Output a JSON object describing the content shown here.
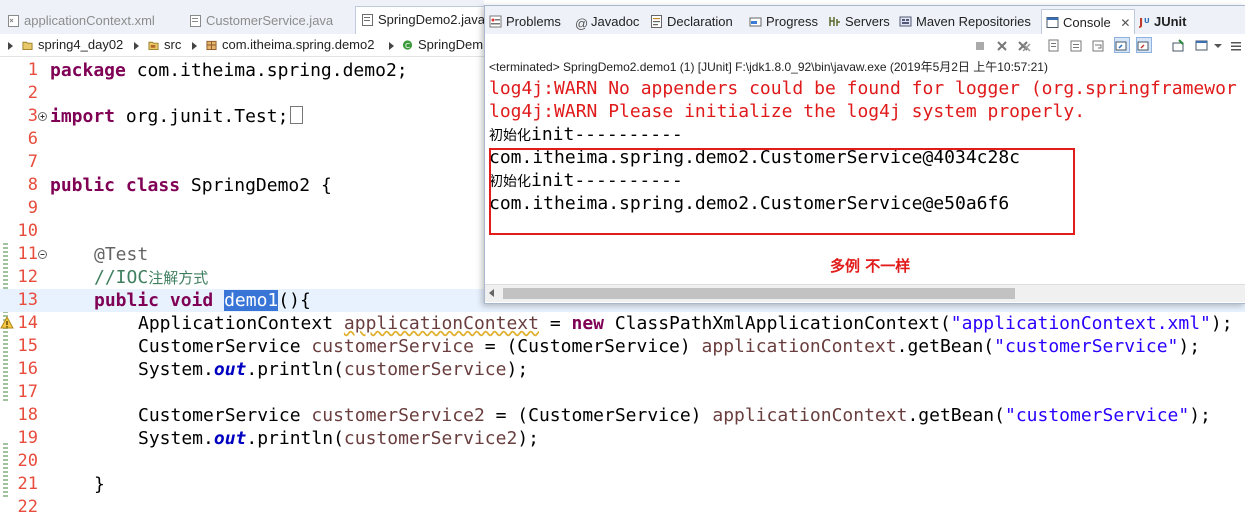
{
  "editor": {
    "tabs": [
      {
        "label": "applicationContext.xml",
        "icon": "xml-file-icon"
      },
      {
        "label": "CustomerService.java",
        "icon": "java-file-icon"
      },
      {
        "label": "SpringDemo2.java",
        "icon": "java-file-icon"
      }
    ],
    "breadcrumb": [
      "spring4_day02",
      "src",
      "com.itheima.spring.demo2",
      "SpringDem"
    ],
    "line_numbers": [
      "1",
      "2",
      "3",
      "6",
      "7",
      "8",
      "9",
      "10",
      "11",
      "12",
      "13",
      "14",
      "15",
      "16",
      "17",
      "18",
      "19",
      "20",
      "21",
      "22"
    ],
    "code": {
      "l1_kw": "package",
      "l1_rest": " com.itheima.spring.demo2;",
      "l3_kw": "import",
      "l3_rest": " org.junit.Test;",
      "l8_kw1": "public",
      "l8_kw2": "class",
      "l8_rest": " SpringDemo2 {",
      "l11": "@Test",
      "l12_prefix": "//IOC",
      "l12_cjk": "注解方式",
      "l13_kw1": "public",
      "l13_kw2": "void",
      "l13_method": "demo1",
      "l13_rest": "(){",
      "l14_type": "ApplicationContext ",
      "l14_var": "applicationContext",
      "l14_eq": " = ",
      "l14_new": "new",
      "l14_cls": " ClassPathXmlApplicationContext(",
      "l14_str": "\"applicationContext.xml\"",
      "l14_end": ");",
      "l15_type": "CustomerService ",
      "l15_var": "customerService",
      "l15_mid": " = (CustomerService) ",
      "l15_var2": "applicationContext",
      "l15_call": ".getBean(",
      "l15_str": "\"customerService\"",
      "l15_end": ");",
      "l16_a": "System.",
      "l16_out": "out",
      "l16_b": ".println(",
      "l16_var": "customerService",
      "l16_end": ");",
      "l18_type": "CustomerService ",
      "l18_var": "customerService2",
      "l18_mid": " = (CustomerService) ",
      "l18_var2": "applicationContext",
      "l18_call": ".getBean(",
      "l18_str": "\"customerService\"",
      "l18_end": ");",
      "l19_a": "System.",
      "l19_out": "out",
      "l19_b": ".println(",
      "l19_var": "customerService2",
      "l19_end": ");",
      "l21": "}"
    }
  },
  "console": {
    "tabs": [
      {
        "label": "Problems",
        "icon": "problems-icon"
      },
      {
        "label": "Javadoc",
        "icon": "javadoc-icon"
      },
      {
        "label": "Declaration",
        "icon": "declaration-icon"
      },
      {
        "label": "Progress",
        "icon": "progress-icon"
      },
      {
        "label": "Servers",
        "icon": "servers-icon"
      },
      {
        "label": "Maven Repositories",
        "icon": "maven-icon"
      },
      {
        "label": "Console",
        "icon": "console-icon"
      },
      {
        "label": "JUnit",
        "icon": "junit-icon"
      }
    ],
    "status": "<terminated> SpringDemo2.demo1 (1) [JUnit] F:\\jdk1.8.0_92\\bin\\javaw.exe (2019年5月2日 上午10:57:21)",
    "lines": [
      {
        "text": "log4j:WARN No appenders could be found for logger (org.springframewor",
        "kind": "error"
      },
      {
        "text": "log4j:WARN Please initialize the log4j system properly.",
        "kind": "error"
      },
      {
        "cjk": "初始化",
        "text": "init----------",
        "kind": "output"
      },
      {
        "text": "com.itheima.spring.demo2.CustomerService@4034c28c",
        "kind": "output"
      },
      {
        "cjk": "初始化",
        "text": "init----------",
        "kind": "output"
      },
      {
        "text": "com.itheima.spring.demo2.CustomerService@e50a6f6",
        "kind": "output"
      }
    ],
    "annotation": "多例 不一样",
    "colors": {
      "error": "#e0191a",
      "annotation": "#e21b1b",
      "line_number": "#e74c3c"
    }
  }
}
